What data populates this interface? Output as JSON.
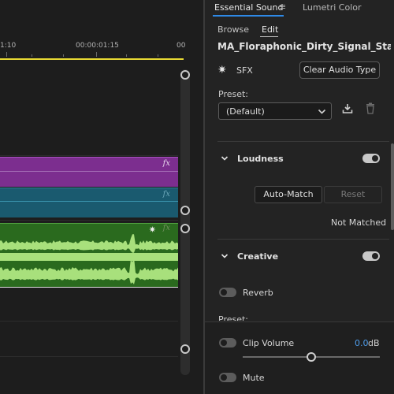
{
  "timeline": {
    "timecode_left": "1:10",
    "timecode_mid": "00:00:01:15",
    "timecode_right": "00",
    "video_clip_1_fx": "fx",
    "video_clip_2_fx": "fx",
    "audio_clip_fx": "fx",
    "audio_clip_badge": "✷"
  },
  "panel": {
    "tabs": {
      "essential_sound": "Essential Sound",
      "menu": "≡",
      "lumetri": "Lumetri Color"
    },
    "sub_tabs": {
      "browse": "Browse",
      "edit": "Edit"
    },
    "clip_name": "MA_Floraphonic_Dirty_Signal_Stat...",
    "audio_type": {
      "icon": "sfx-burst-icon",
      "glyph": "✷",
      "label": "SFX"
    },
    "clear_button": "Clear Audio Type",
    "preset": {
      "label": "Preset:",
      "value": "(Default)"
    },
    "loudness": {
      "title": "Loudness",
      "enabled": true,
      "auto_match": "Auto-Match",
      "reset": "Reset",
      "status": "Not Matched"
    },
    "creative": {
      "title": "Creative",
      "enabled": true,
      "reverb": {
        "label": "Reverb",
        "enabled": false,
        "preset_label": "Preset:"
      }
    },
    "clip_volume": {
      "label": "Clip Volume",
      "enabled": false,
      "value": "0.0",
      "unit": "dB",
      "slider_fraction": 0.5
    },
    "mute": {
      "label": "Mute",
      "enabled": false
    }
  },
  "colors": {
    "accent_blue": "#2e89e6",
    "work_area_yellow": "#e8d934",
    "video_clip_purple": "#7c2e8f",
    "video_clip_teal": "#1a5a6f",
    "audio_clip_green": "#2a6a1e",
    "waveform_green": "#a8e07c"
  }
}
